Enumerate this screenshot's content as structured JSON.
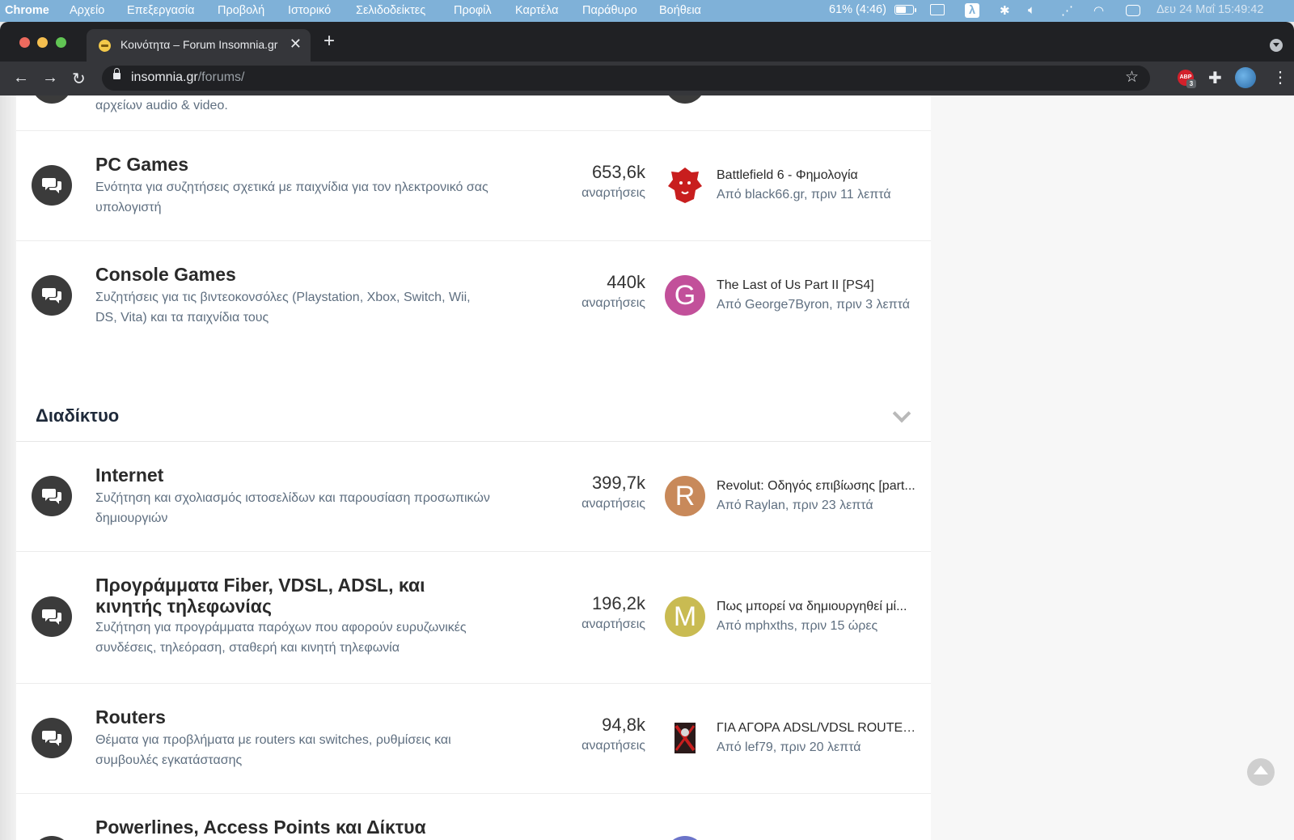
{
  "menubar": {
    "app": "Chrome",
    "items": [
      "Αρχείο",
      "Επεξεργασία",
      "Προβολή",
      "Ιστορικό",
      "Σελιδοδείκτες",
      "Προφίλ",
      "Καρτέλα",
      "Παράθυρο",
      "Βοήθεια"
    ],
    "battery": "61% (4:46)",
    "battery_level": 0.61,
    "lambda": "λ",
    "datetime": "Δευ 24 Μαΐ  15:49:42"
  },
  "browser": {
    "tab_title": "Κοινότητα – Forum Insomnia.gr",
    "tab_close": "✕",
    "new_tab": "+",
    "url_host": "insomnia.gr",
    "url_path": "/forums/",
    "star": "☆",
    "abp_label": "ABP",
    "abp_count": "3",
    "back": "←",
    "forward": "→",
    "reload": "↻",
    "puzzle": "✚",
    "menu": "⋮"
  },
  "partial_top": {
    "desc": "αρχείων audio & video."
  },
  "forums_top": [
    {
      "title": "PC Games",
      "desc": "Ενότητα για συζητήσεις σχετικά με παιχνίδια για τον ηλεκτρονικό σας υπολογιστή",
      "count": "653,6k",
      "count_label": "αναρτήσεις",
      "last_title": "Battlefield 6 - Φημολογία",
      "last_by": "Από black66.gr, πριν 11 λεπτά",
      "avatar_letter": "",
      "avatar_color": "#ffffff",
      "avatar_icon": "lion-logo"
    },
    {
      "title": "Console Games",
      "desc": "Συζητήσεις για τις βιντεοκονσόλες (Playstation, Xbox, Switch, Wii, DS, Vita) και τα παιχνίδια τους",
      "count": "440k",
      "count_label": "αναρτήσεις",
      "last_title": "The Last of Us Part II [PS4]",
      "last_by": "Από George7Byron, πριν 3 λεπτά",
      "avatar_letter": "G",
      "avatar_color": "#c2509a"
    }
  ],
  "section": {
    "title": "Διαδίκτυο"
  },
  "forums_section": [
    {
      "title": "Internet",
      "desc": "Συζήτηση και σχολιασμός ιστοσελίδων και παρουσίαση προσωπικών δημιουργιών",
      "count": "399,7k",
      "count_label": "αναρτήσεις",
      "last_title": "Revolut: Οδηγός επιβίωσης [part...",
      "last_by": "Από Raylan, πριν 23 λεπτά",
      "avatar_letter": "R",
      "avatar_color": "#c8895a"
    },
    {
      "title": "Προγράμματα Fiber, VDSL, ADSL, και κινητής τηλεφωνίας",
      "desc": "Συζήτηση για προγράμματα παρόχων που αφορούν ευρυζωνικές συνδέσεις, τηλεόραση, σταθερή και κινητή τηλεφωνία",
      "count": "196,2k",
      "count_label": "αναρτήσεις",
      "last_title": "Πως μπορεί να δημιουργηθεί μί...",
      "last_by": "Από mphxths, πριν 15 ώρες",
      "avatar_letter": "M",
      "avatar_color": "#c9bb52"
    },
    {
      "title": "Routers",
      "desc": "Θέματα για προβλήματα με routers και switches, ρυθμίσεις και συμβουλές εγκατάστασης",
      "count": "94,8k",
      "count_label": "αναρτήσεις",
      "last_title": "ΓΙΑ ΑΓΟΡΑ ADSL/VDSL ROUTER...",
      "last_by": "Από lef79, πριν 20 λεπτά",
      "avatar_letter": "",
      "avatar_color": "#ffffff",
      "avatar_icon": "dark-figure-logo"
    },
    {
      "title": "Powerlines, Access Points και Δίκτυα",
      "desc": "",
      "count": "",
      "count_label": "",
      "last_title": "",
      "last_by": "",
      "avatar_letter": "",
      "avatar_color": "#6b74c9"
    }
  ],
  "colors": {
    "menubar": "#7fb1d8",
    "chrome_dark": "#202124",
    "chrome_toolbar": "#35363a",
    "title_text": "#2a2a2a",
    "muted_text": "#5f6f80",
    "forum_icon_bg": "#3b3b3b"
  }
}
